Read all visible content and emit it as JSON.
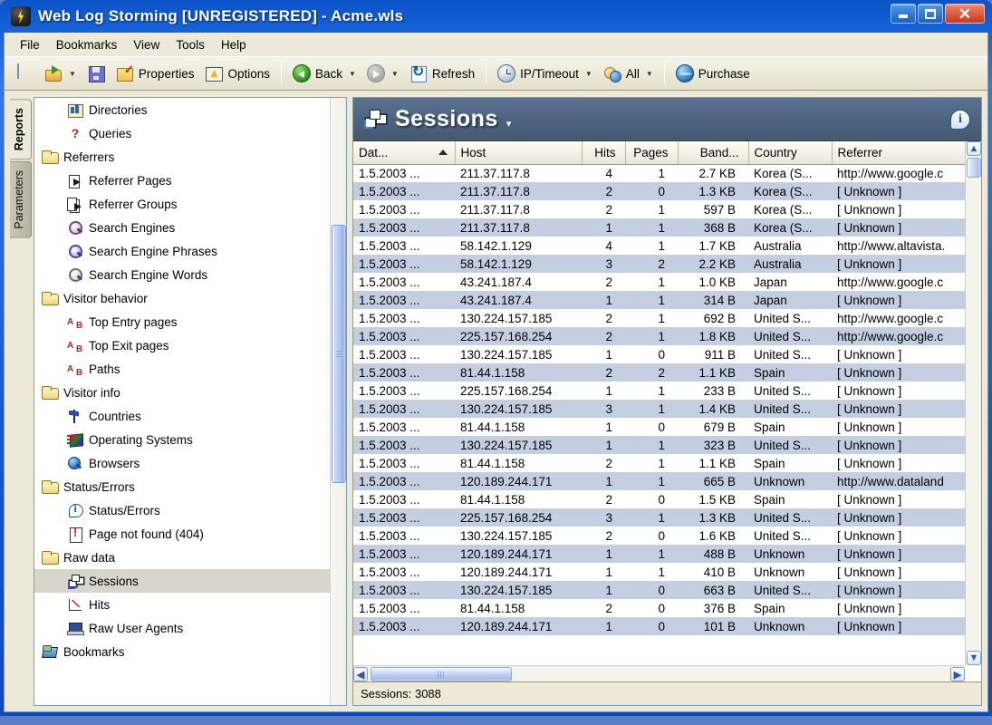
{
  "window": {
    "title": "Web Log Storming  [UNREGISTERED] - Acme.wls",
    "app_icon": "lightning-bolt-icon",
    "minimize_label": "",
    "maximize_label": "",
    "close_label": "✕"
  },
  "menu": {
    "items": [
      {
        "label": "File"
      },
      {
        "label": "Bookmarks"
      },
      {
        "label": "View"
      },
      {
        "label": "Tools"
      },
      {
        "label": "Help"
      }
    ]
  },
  "toolbar": {
    "new_label": "",
    "open_label": "",
    "save_label": "",
    "properties_label": "Properties",
    "options_label": "Options",
    "back_label": "Back",
    "forward_label": "",
    "refresh_label": "Refresh",
    "iptimeout_label": "IP/Timeout",
    "all_label": "All",
    "purchase_label": "Purchase",
    "dropdown_glyph": "▼"
  },
  "side_tabs": [
    {
      "label": "Reports",
      "active": true
    },
    {
      "label": "Parameters",
      "active": false
    }
  ],
  "tree": {
    "items": [
      {
        "label": "Directories",
        "level": 1,
        "icon": "directories-icon",
        "selected": false
      },
      {
        "label": "Queries",
        "level": 1,
        "icon": "queries-icon",
        "selected": false
      },
      {
        "label": "Referrers",
        "level": 0,
        "icon": "folder-icon",
        "selected": false
      },
      {
        "label": "Referrer Pages",
        "level": 1,
        "icon": "referrer-page-icon",
        "selected": false
      },
      {
        "label": "Referrer Groups",
        "level": 1,
        "icon": "referrer-group-icon",
        "selected": false
      },
      {
        "label": "Search Engines",
        "level": 1,
        "icon": "magnifier-pink-icon",
        "selected": false
      },
      {
        "label": "Search Engine Phrases",
        "level": 1,
        "icon": "magnifier-purple-icon",
        "selected": false
      },
      {
        "label": "Search Engine Words",
        "level": 1,
        "icon": "magnifier-icon",
        "selected": false
      },
      {
        "label": "Visitor behavior",
        "level": 0,
        "icon": "folder-icon",
        "selected": false
      },
      {
        "label": "Top Entry pages",
        "level": 1,
        "icon": "a-to-b-icon",
        "selected": false
      },
      {
        "label": "Top Exit pages",
        "level": 1,
        "icon": "a-to-b-icon",
        "selected": false
      },
      {
        "label": "Paths",
        "level": 1,
        "icon": "a-to-b-icon",
        "selected": false
      },
      {
        "label": "Visitor info",
        "level": 0,
        "icon": "folder-icon",
        "selected": false
      },
      {
        "label": "Countries",
        "level": 1,
        "icon": "flag-icon",
        "selected": false
      },
      {
        "label": "Operating Systems",
        "level": 1,
        "icon": "operating-systems-icon",
        "selected": false
      },
      {
        "label": "Browsers",
        "level": 1,
        "icon": "browser-icon",
        "selected": false
      },
      {
        "label": "Status/Errors",
        "level": 0,
        "icon": "folder-icon",
        "selected": false
      },
      {
        "label": "Status/Errors",
        "level": 1,
        "icon": "info-icon",
        "selected": false
      },
      {
        "label": "Page not found (404)",
        "level": 1,
        "icon": "warning-page-icon",
        "selected": false
      },
      {
        "label": "Raw data",
        "level": 0,
        "icon": "folder-icon",
        "selected": false
      },
      {
        "label": "Sessions",
        "level": 1,
        "icon": "sessions-icon",
        "selected": true
      },
      {
        "label": "Hits",
        "level": 1,
        "icon": "hits-chart-icon",
        "selected": false
      },
      {
        "label": "Raw User Agents",
        "level": 1,
        "icon": "user-agents-icon",
        "selected": false
      },
      {
        "label": "Bookmarks",
        "level": 0,
        "icon": "bookmarks-icon",
        "selected": false
      }
    ]
  },
  "report": {
    "title": "Sessions",
    "title_dropdown_glyph": "▾",
    "icon": "sessions-icon",
    "info_icon_label": "i"
  },
  "grid": {
    "columns": [
      {
        "key": "date",
        "label": "Dat...",
        "sorted": true,
        "align": "left"
      },
      {
        "key": "host",
        "label": "Host",
        "sorted": false,
        "align": "left"
      },
      {
        "key": "hits",
        "label": "Hits",
        "sorted": false,
        "align": "right"
      },
      {
        "key": "pages",
        "label": "Pages",
        "sorted": false,
        "align": "right"
      },
      {
        "key": "bandwidth",
        "label": "Band...",
        "sorted": false,
        "align": "right"
      },
      {
        "key": "country",
        "label": "Country",
        "sorted": false,
        "align": "left"
      },
      {
        "key": "referrer",
        "label": "Referrer",
        "sorted": false,
        "align": "left"
      }
    ],
    "sort_indicator": "ascending",
    "rows": [
      {
        "date": "1.5.2003 ...",
        "host": "211.37.117.8",
        "hits": "4",
        "pages": "1",
        "bandwidth": "2.7 KB",
        "country": "Korea (S...",
        "referrer": "http://www.google.c"
      },
      {
        "date": "1.5.2003 ...",
        "host": "211.37.117.8",
        "hits": "2",
        "pages": "0",
        "bandwidth": "1.3 KB",
        "country": "Korea (S...",
        "referrer": "[ Unknown ]"
      },
      {
        "date": "1.5.2003 ...",
        "host": "211.37.117.8",
        "hits": "2",
        "pages": "1",
        "bandwidth": "597 B",
        "country": "Korea (S...",
        "referrer": "[ Unknown ]"
      },
      {
        "date": "1.5.2003 ...",
        "host": "211.37.117.8",
        "hits": "1",
        "pages": "1",
        "bandwidth": "368 B",
        "country": "Korea (S...",
        "referrer": "[ Unknown ]"
      },
      {
        "date": "1.5.2003 ...",
        "host": "58.142.1.129",
        "hits": "4",
        "pages": "1",
        "bandwidth": "1.7 KB",
        "country": "Australia",
        "referrer": "http://www.altavista."
      },
      {
        "date": "1.5.2003 ...",
        "host": "58.142.1.129",
        "hits": "3",
        "pages": "2",
        "bandwidth": "2.2 KB",
        "country": "Australia",
        "referrer": "[ Unknown ]"
      },
      {
        "date": "1.5.2003 ...",
        "host": "43.241.187.4",
        "hits": "2",
        "pages": "1",
        "bandwidth": "1.0 KB",
        "country": "Japan",
        "referrer": "http://www.google.c"
      },
      {
        "date": "1.5.2003 ...",
        "host": "43.241.187.4",
        "hits": "1",
        "pages": "1",
        "bandwidth": "314 B",
        "country": "Japan",
        "referrer": "[ Unknown ]"
      },
      {
        "date": "1.5.2003 ...",
        "host": "130.224.157.185",
        "hits": "2",
        "pages": "1",
        "bandwidth": "692 B",
        "country": "United S...",
        "referrer": "http://www.google.c"
      },
      {
        "date": "1.5.2003 ...",
        "host": "225.157.168.254",
        "hits": "2",
        "pages": "1",
        "bandwidth": "1.8 KB",
        "country": "United S...",
        "referrer": "http://www.google.c"
      },
      {
        "date": "1.5.2003 ...",
        "host": "130.224.157.185",
        "hits": "1",
        "pages": "0",
        "bandwidth": "911 B",
        "country": "United S...",
        "referrer": "[ Unknown ]"
      },
      {
        "date": "1.5.2003 ...",
        "host": "81.44.1.158",
        "hits": "2",
        "pages": "2",
        "bandwidth": "1.1 KB",
        "country": "Spain",
        "referrer": "[ Unknown ]"
      },
      {
        "date": "1.5.2003 ...",
        "host": "225.157.168.254",
        "hits": "1",
        "pages": "1",
        "bandwidth": "233 B",
        "country": "United S...",
        "referrer": "[ Unknown ]"
      },
      {
        "date": "1.5.2003 ...",
        "host": "130.224.157.185",
        "hits": "3",
        "pages": "1",
        "bandwidth": "1.4 KB",
        "country": "United S...",
        "referrer": "[ Unknown ]"
      },
      {
        "date": "1.5.2003 ...",
        "host": "81.44.1.158",
        "hits": "1",
        "pages": "0",
        "bandwidth": "679 B",
        "country": "Spain",
        "referrer": "[ Unknown ]"
      },
      {
        "date": "1.5.2003 ...",
        "host": "130.224.157.185",
        "hits": "1",
        "pages": "1",
        "bandwidth": "323 B",
        "country": "United S...",
        "referrer": "[ Unknown ]"
      },
      {
        "date": "1.5.2003 ...",
        "host": "81.44.1.158",
        "hits": "2",
        "pages": "1",
        "bandwidth": "1.1 KB",
        "country": "Spain",
        "referrer": "[ Unknown ]"
      },
      {
        "date": "1.5.2003 ...",
        "host": "120.189.244.171",
        "hits": "1",
        "pages": "1",
        "bandwidth": "665 B",
        "country": "Unknown",
        "referrer": "http://www.dataland"
      },
      {
        "date": "1.5.2003 ...",
        "host": "81.44.1.158",
        "hits": "2",
        "pages": "0",
        "bandwidth": "1.5 KB",
        "country": "Spain",
        "referrer": "[ Unknown ]"
      },
      {
        "date": "1.5.2003 ...",
        "host": "225.157.168.254",
        "hits": "3",
        "pages": "1",
        "bandwidth": "1.3 KB",
        "country": "United S...",
        "referrer": "[ Unknown ]"
      },
      {
        "date": "1.5.2003 ...",
        "host": "130.224.157.185",
        "hits": "2",
        "pages": "0",
        "bandwidth": "1.6 KB",
        "country": "United S...",
        "referrer": "[ Unknown ]"
      },
      {
        "date": "1.5.2003 ...",
        "host": "120.189.244.171",
        "hits": "1",
        "pages": "1",
        "bandwidth": "488 B",
        "country": "Unknown",
        "referrer": "[ Unknown ]"
      },
      {
        "date": "1.5.2003 ...",
        "host": "120.189.244.171",
        "hits": "1",
        "pages": "1",
        "bandwidth": "410 B",
        "country": "Unknown",
        "referrer": "[ Unknown ]"
      },
      {
        "date": "1.5.2003 ...",
        "host": "130.224.157.185",
        "hits": "1",
        "pages": "0",
        "bandwidth": "663 B",
        "country": "United S...",
        "referrer": "[ Unknown ]"
      },
      {
        "date": "1.5.2003 ...",
        "host": "81.44.1.158",
        "hits": "2",
        "pages": "0",
        "bandwidth": "376 B",
        "country": "Spain",
        "referrer": "[ Unknown ]"
      },
      {
        "date": "1.5.2003 ...",
        "host": "120.189.244.171",
        "hits": "1",
        "pages": "0",
        "bandwidth": "101 B",
        "country": "Unknown",
        "referrer": "[ Unknown ]"
      }
    ]
  },
  "scrollbars": {
    "up_glyph": "▲",
    "down_glyph": "▼",
    "left_glyph": "◀",
    "right_glyph": "▶"
  },
  "statusbar": {
    "text": "Sessions: 3088"
  },
  "colors": {
    "titlebar_blue": "#0f5ad2",
    "report_header": "#4e6583",
    "alt_row": "#c3cfe0",
    "selection": "#d8d5cb",
    "chrome": "#ece9d8"
  }
}
